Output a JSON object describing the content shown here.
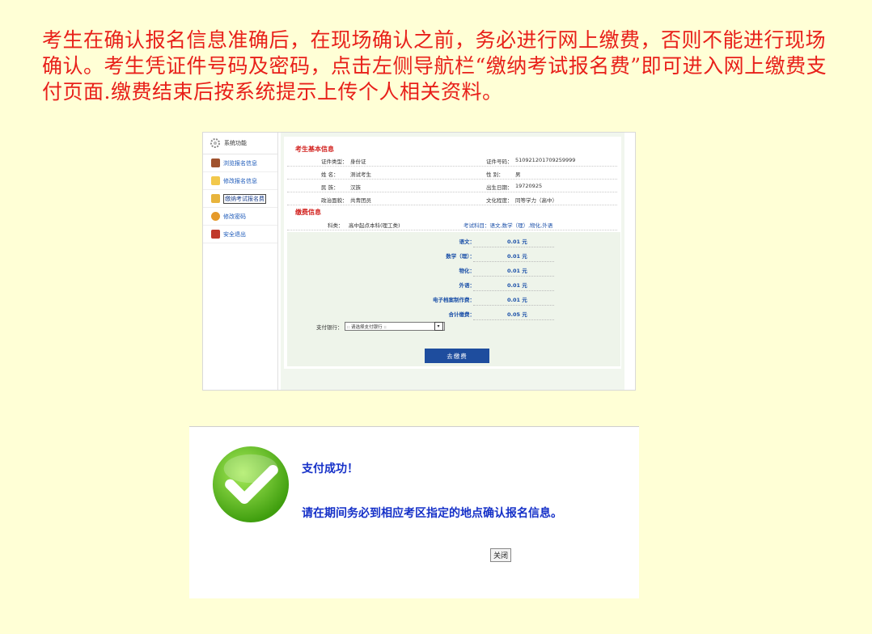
{
  "intro": "考生在确认报名信息准确后，在现场确认之前，务必进行网上缴费，否则不能进行现场确认。考生凭证件号码及密码，点击左侧导航栏“缴纳考试报名费”即可进入网上缴费支付页面.缴费结束后按系统提示上传个人相关资料。",
  "sidebar": {
    "header": "系统功能",
    "items": [
      {
        "label": "浏览报名信息",
        "icon": "book-icon"
      },
      {
        "label": "修改报名信息",
        "icon": "edit-icon"
      },
      {
        "label": "缴纳考试报名费",
        "icon": "pay-icon"
      },
      {
        "label": "修改密码",
        "icon": "user-key-icon"
      },
      {
        "label": "安全退出",
        "icon": "exit-icon"
      }
    ]
  },
  "basic": {
    "title": "考生基本信息",
    "id_type_label": "证件类型：",
    "id_type": "身份证",
    "id_no_label": "证件号码：",
    "id_no": "510921201709259999",
    "name_label": "姓    名：",
    "name": "测试考生",
    "gender_label": "性    别：",
    "gender": "男",
    "ethnic_label": "民    族：",
    "ethnic": "汉族",
    "birth_label": "出生日期：",
    "birth": "19720925",
    "political_label": "政治面貌：",
    "political": "共青团员",
    "education_label": "文化程度：",
    "education": "同等学力（高中）"
  },
  "fees": {
    "title": "缴费信息",
    "category_label": "科类：",
    "category": "高中起点本科(理工类)",
    "subjects": "考试科目：语文,数学（理）,物化,外语",
    "items": [
      {
        "label": "语文：",
        "value": "0.01 元"
      },
      {
        "label": "数学（理）：",
        "value": "0.01 元"
      },
      {
        "label": "物化：",
        "value": "0.01 元"
      },
      {
        "label": "外语：",
        "value": "0.01 元"
      },
      {
        "label": "电子档案制作费：",
        "value": "0.01 元"
      },
      {
        "label": "合计缴费：",
        "value": "0.05 元"
      }
    ],
    "bank_label": "支付银行：",
    "bank_placeholder": ":: 请选择支付银行 ::",
    "pay_button": "去缴费"
  },
  "success": {
    "title": "支付成功！",
    "message": "请在期间务必到相应考区指定的地点确认报名信息。",
    "close_button": "关闭"
  },
  "colors": {
    "intro_text": "#e8201a",
    "page_bg": "#ffffd6",
    "accent_blue": "#1e4d9e",
    "check_green": "#5cc21c"
  }
}
